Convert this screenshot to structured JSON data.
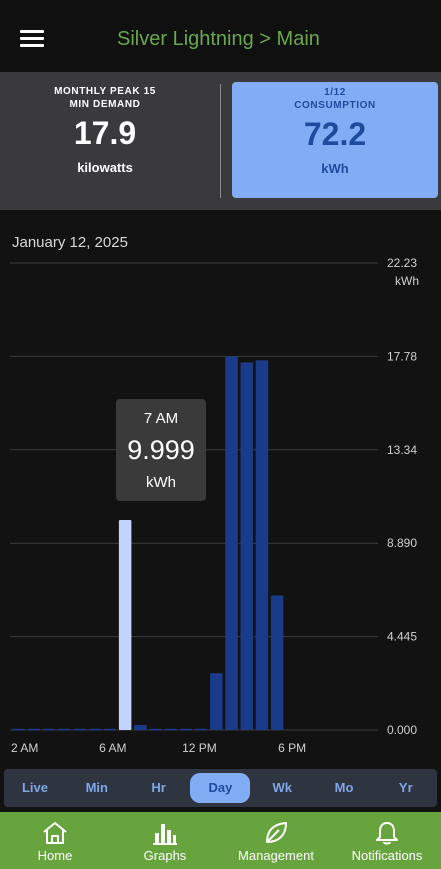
{
  "header": {
    "title": "Silver Lightning > Main"
  },
  "summary": {
    "peak": {
      "label_line1": "MONTHLY PEAK 15",
      "label_line2": "MIN DEMAND",
      "value": "17.9",
      "unit": "kilowatts"
    },
    "consumption": {
      "date": "1/12",
      "label": "CONSUMPTION",
      "value": "72.2",
      "unit": "kWh"
    }
  },
  "chart_header": {
    "date": "January 12, 2025"
  },
  "tooltip": {
    "time": "7 AM",
    "value": "9.999",
    "unit": "kWh"
  },
  "chart_data": {
    "type": "bar",
    "x_tick_labels": [
      "2 AM",
      "6 AM",
      "12 PM",
      "6 PM"
    ],
    "y_tick_labels": [
      "0.000",
      "4.445",
      "8.890",
      "13.34",
      "17.78",
      "22.23"
    ],
    "y_unit": "kWh",
    "ylim": [
      0,
      22.23
    ],
    "grid": true,
    "highlighted_hour": 7,
    "hours": [
      0,
      1,
      2,
      3,
      4,
      5,
      6,
      7,
      8,
      9,
      10,
      11,
      12,
      13,
      14,
      15,
      16,
      17
    ],
    "values": [
      0.06,
      0.06,
      0.06,
      0.06,
      0.06,
      0.06,
      0.06,
      9.999,
      0.24,
      0.06,
      0.06,
      0.06,
      0.06,
      2.7,
      17.78,
      17.5,
      17.6,
      6.4
    ],
    "colors": {
      "bar": "#1a3a8a",
      "highlight": "#c3d3ff",
      "grid": "#3a3a3a"
    }
  },
  "periods": [
    {
      "label": "Live"
    },
    {
      "label": "Min"
    },
    {
      "label": "Hr"
    },
    {
      "label": "Day",
      "active": true
    },
    {
      "label": "Wk"
    },
    {
      "label": "Mo"
    },
    {
      "label": "Yr"
    }
  ],
  "nav": [
    {
      "label": "Home",
      "icon": "home-icon"
    },
    {
      "label": "Graphs",
      "icon": "bar-chart-icon"
    },
    {
      "label": "Management",
      "icon": "leaf-icon"
    },
    {
      "label": "Notifications",
      "icon": "bell-icon"
    }
  ]
}
